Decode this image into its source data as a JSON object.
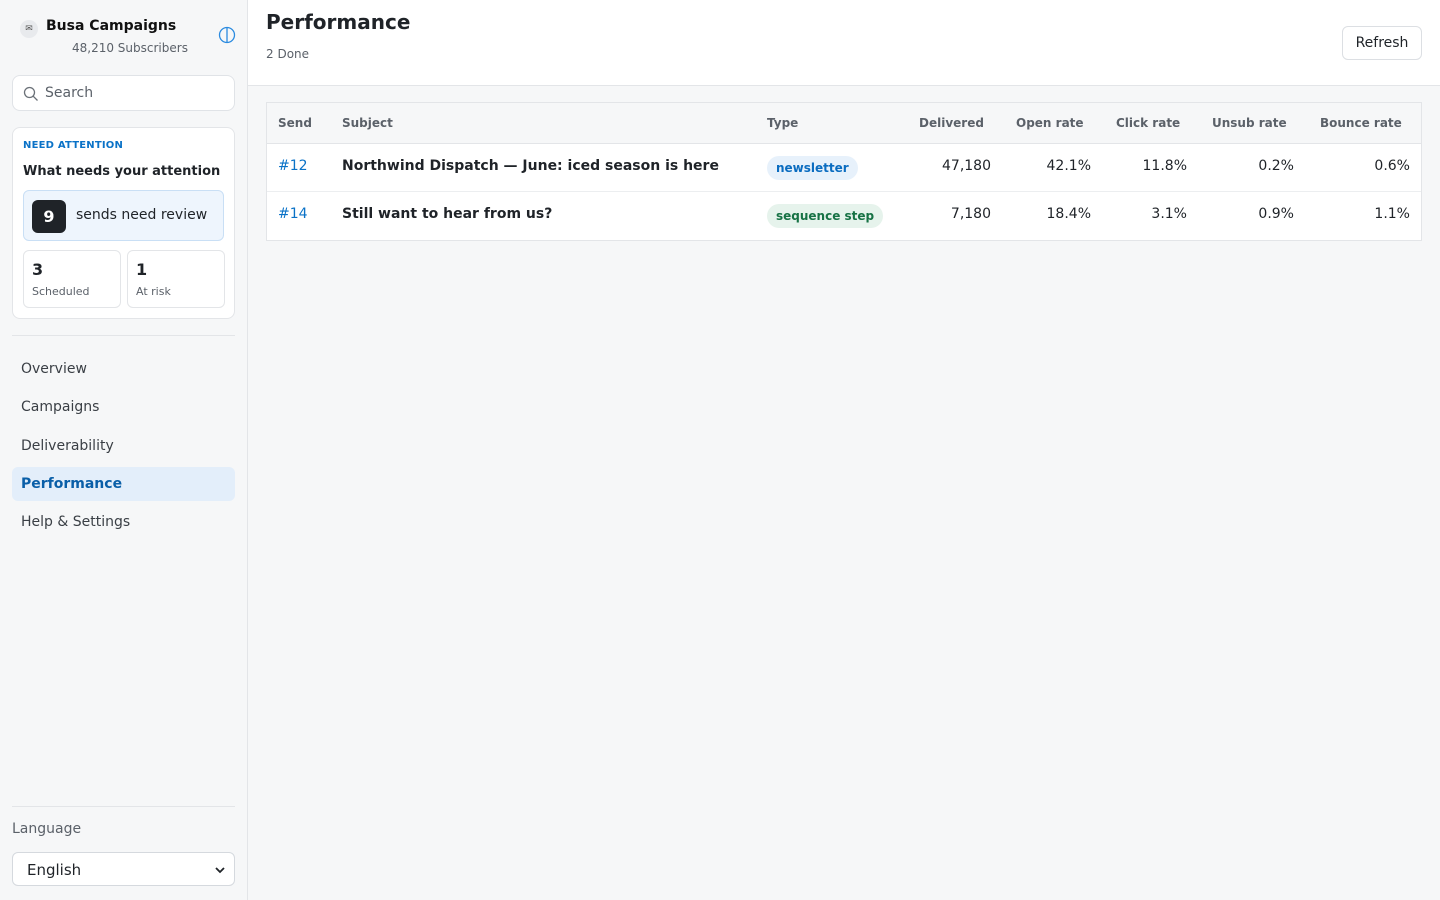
{
  "brand": {
    "name": "Busa Campaigns",
    "subscribers": "48,210 Subscribers",
    "icon": "mail-icon"
  },
  "search": {
    "placeholder": "Search",
    "value": ""
  },
  "attention": {
    "kicker": "NEED ATTENTION",
    "title": "What needs your attention",
    "review_count": "9",
    "review_label": "sends need review",
    "stats": [
      {
        "value": "3",
        "label": "Scheduled"
      },
      {
        "value": "1",
        "label": "At risk"
      }
    ]
  },
  "nav": {
    "items": [
      {
        "label": "Overview",
        "active": false
      },
      {
        "label": "Campaigns",
        "active": false
      },
      {
        "label": "Deliverability",
        "active": false
      },
      {
        "label": "Performance",
        "active": true
      },
      {
        "label": "Help & Settings",
        "active": false
      }
    ]
  },
  "language": {
    "label": "Language",
    "selected": "English"
  },
  "header": {
    "title": "Performance",
    "status": "2 Done",
    "refresh_label": "Refresh"
  },
  "table": {
    "columns": [
      "Send",
      "Subject",
      "Type",
      "Delivered",
      "Open rate",
      "Click rate",
      "Unsub rate",
      "Bounce rate"
    ],
    "rows": [
      {
        "send": "#12",
        "subject": "Northwind Dispatch — June: iced season is here",
        "type": "newsletter",
        "delivered": "47,180",
        "open_rate": "42.1%",
        "click_rate": "11.8%",
        "unsub_rate": "0.2%",
        "bounce_rate": "0.6%"
      },
      {
        "send": "#14",
        "subject": "Still want to hear from us?",
        "type": "sequence step",
        "delivered": "7,180",
        "open_rate": "18.4%",
        "click_rate": "3.1%",
        "unsub_rate": "0.9%",
        "bounce_rate": "1.1%"
      }
    ]
  },
  "colors": {
    "accent": "#0a72c7",
    "active_nav_bg": "#e3eefa",
    "newsletter_badge": "#e7f1fb",
    "sequence_badge": "#e6f3ec"
  }
}
